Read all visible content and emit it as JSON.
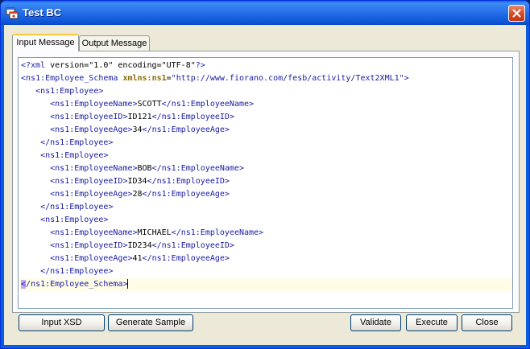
{
  "window": {
    "title": "Test BC",
    "title_color": "#ffffff",
    "accent": "#0a5ddf"
  },
  "tabs": [
    {
      "label": "Input Message",
      "active": true
    },
    {
      "label": "Output Message",
      "active": false
    }
  ],
  "editor": {
    "lines": [
      {
        "indent": "",
        "parts": [
          {
            "c": "pi",
            "t": "<?xml "
          },
          {
            "c": "piattr",
            "t": "version=\"1.0\" encoding=\"UTF-8\""
          },
          {
            "c": "pi",
            "t": "?>"
          }
        ]
      },
      {
        "indent": "",
        "parts": [
          {
            "c": "punct",
            "t": "<"
          },
          {
            "c": "tagname",
            "t": "ns1:Employee_Schema "
          },
          {
            "c": "attr",
            "t": "xmlns:ns1"
          },
          {
            "c": "text",
            "t": "="
          },
          {
            "c": "attrval",
            "t": "\"http://www.fiorano.com/fesb/activity/Text2XML1\""
          },
          {
            "c": "punct",
            "t": ">"
          }
        ]
      },
      {
        "indent": "   ",
        "parts": [
          {
            "c": "punct",
            "t": "<"
          },
          {
            "c": "tagname",
            "t": "ns1:Employee"
          },
          {
            "c": "punct",
            "t": ">"
          }
        ]
      },
      {
        "indent": "      ",
        "parts": [
          {
            "c": "punct",
            "t": "<"
          },
          {
            "c": "tagname",
            "t": "ns1:EmployeeName"
          },
          {
            "c": "punct",
            "t": ">"
          },
          {
            "c": "text",
            "t": "SCOTT"
          },
          {
            "c": "punct",
            "t": "</"
          },
          {
            "c": "tagname",
            "t": "ns1:EmployeeName"
          },
          {
            "c": "punct",
            "t": ">"
          }
        ]
      },
      {
        "indent": "      ",
        "parts": [
          {
            "c": "punct",
            "t": "<"
          },
          {
            "c": "tagname",
            "t": "ns1:EmployeeID"
          },
          {
            "c": "punct",
            "t": ">"
          },
          {
            "c": "text",
            "t": "ID121"
          },
          {
            "c": "punct",
            "t": "</"
          },
          {
            "c": "tagname",
            "t": "ns1:EmployeeID"
          },
          {
            "c": "punct",
            "t": ">"
          }
        ]
      },
      {
        "indent": "      ",
        "parts": [
          {
            "c": "punct",
            "t": "<"
          },
          {
            "c": "tagname",
            "t": "ns1:EmployeeAge"
          },
          {
            "c": "punct",
            "t": ">"
          },
          {
            "c": "text",
            "t": "34"
          },
          {
            "c": "punct",
            "t": "</"
          },
          {
            "c": "tagname",
            "t": "ns1:EmployeeAge"
          },
          {
            "c": "punct",
            "t": ">"
          }
        ]
      },
      {
        "indent": "    ",
        "parts": [
          {
            "c": "punct",
            "t": "</"
          },
          {
            "c": "tagname",
            "t": "ns1:Employee"
          },
          {
            "c": "punct",
            "t": ">"
          }
        ]
      },
      {
        "indent": "    ",
        "parts": [
          {
            "c": "punct",
            "t": "<"
          },
          {
            "c": "tagname",
            "t": "ns1:Employee"
          },
          {
            "c": "punct",
            "t": ">"
          }
        ]
      },
      {
        "indent": "      ",
        "parts": [
          {
            "c": "punct",
            "t": "<"
          },
          {
            "c": "tagname",
            "t": "ns1:EmployeeName"
          },
          {
            "c": "punct",
            "t": ">"
          },
          {
            "c": "text",
            "t": "BOB"
          },
          {
            "c": "punct",
            "t": "</"
          },
          {
            "c": "tagname",
            "t": "ns1:EmployeeName"
          },
          {
            "c": "punct",
            "t": ">"
          }
        ]
      },
      {
        "indent": "      ",
        "parts": [
          {
            "c": "punct",
            "t": "<"
          },
          {
            "c": "tagname",
            "t": "ns1:EmployeeID"
          },
          {
            "c": "punct",
            "t": ">"
          },
          {
            "c": "text",
            "t": "ID34"
          },
          {
            "c": "punct",
            "t": "</"
          },
          {
            "c": "tagname",
            "t": "ns1:EmployeeID"
          },
          {
            "c": "punct",
            "t": ">"
          }
        ]
      },
      {
        "indent": "      ",
        "parts": [
          {
            "c": "punct",
            "t": "<"
          },
          {
            "c": "tagname",
            "t": "ns1:EmployeeAge"
          },
          {
            "c": "punct",
            "t": ">"
          },
          {
            "c": "text",
            "t": "28"
          },
          {
            "c": "punct",
            "t": "</"
          },
          {
            "c": "tagname",
            "t": "ns1:EmployeeAge"
          },
          {
            "c": "punct",
            "t": ">"
          }
        ]
      },
      {
        "indent": "    ",
        "parts": [
          {
            "c": "punct",
            "t": "</"
          },
          {
            "c": "tagname",
            "t": "ns1:Employee"
          },
          {
            "c": "punct",
            "t": ">"
          }
        ]
      },
      {
        "indent": "    ",
        "parts": [
          {
            "c": "punct",
            "t": "<"
          },
          {
            "c": "tagname",
            "t": "ns1:Employee"
          },
          {
            "c": "punct",
            "t": ">"
          }
        ]
      },
      {
        "indent": "      ",
        "parts": [
          {
            "c": "punct",
            "t": "<"
          },
          {
            "c": "tagname",
            "t": "ns1:EmployeeName"
          },
          {
            "c": "punct",
            "t": ">"
          },
          {
            "c": "text",
            "t": "MICHAEL"
          },
          {
            "c": "punct",
            "t": "</"
          },
          {
            "c": "tagname",
            "t": "ns1:EmployeeName"
          },
          {
            "c": "punct",
            "t": ">"
          }
        ]
      },
      {
        "indent": "      ",
        "parts": [
          {
            "c": "punct",
            "t": "<"
          },
          {
            "c": "tagname",
            "t": "ns1:EmployeeID"
          },
          {
            "c": "punct",
            "t": ">"
          },
          {
            "c": "text",
            "t": "ID234"
          },
          {
            "c": "punct",
            "t": "</"
          },
          {
            "c": "tagname",
            "t": "ns1:EmployeeID"
          },
          {
            "c": "punct",
            "t": ">"
          }
        ]
      },
      {
        "indent": "      ",
        "parts": [
          {
            "c": "punct",
            "t": "<"
          },
          {
            "c": "tagname",
            "t": "ns1:EmployeeAge"
          },
          {
            "c": "punct",
            "t": ">"
          },
          {
            "c": "text",
            "t": "41"
          },
          {
            "c": "punct",
            "t": "</"
          },
          {
            "c": "tagname",
            "t": "ns1:EmployeeAge"
          },
          {
            "c": "punct",
            "t": ">"
          }
        ]
      },
      {
        "indent": "    ",
        "parts": [
          {
            "c": "punct",
            "t": "</"
          },
          {
            "c": "tagname",
            "t": "ns1:Employee"
          },
          {
            "c": "punct",
            "t": ">"
          }
        ]
      },
      {
        "indent": "",
        "current": true,
        "parts": [
          {
            "c": "punct mark",
            "t": "<"
          },
          {
            "c": "punct",
            "t": "/"
          },
          {
            "c": "tagname",
            "t": "ns1:Employee_Schema"
          },
          {
            "c": "punct",
            "t": ">"
          }
        ]
      }
    ]
  },
  "buttons": {
    "input_xsd": "Input XSD",
    "generate_sample": "Generate Sample",
    "validate": "Validate",
    "execute": "Execute",
    "close": "Close"
  },
  "icons": {
    "app": "app-window-icon",
    "close": "close-icon"
  }
}
